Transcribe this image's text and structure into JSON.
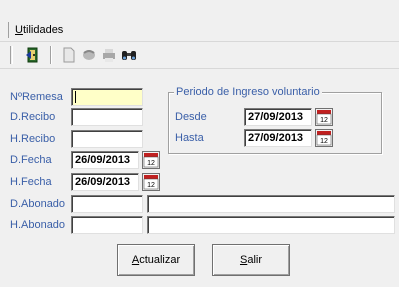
{
  "menu": {
    "utilidades": "Utilidades"
  },
  "toolbar": {
    "icons": [
      "exit-door-icon",
      "new-document-icon",
      "refresh-icon",
      "print-icon",
      "binoculars-search-icon"
    ]
  },
  "form": {
    "nremesa": {
      "label": "NºRemesa",
      "value": ""
    },
    "drecibo": {
      "label": "D.Recibo",
      "value": ""
    },
    "hrecibo": {
      "label": "H.Recibo",
      "value": ""
    },
    "dfecha": {
      "label": "D.Fecha",
      "value": "26/09/2013"
    },
    "hfecha": {
      "label": "H.Fecha",
      "value": "26/09/2013"
    },
    "dabonado": {
      "label": "D.Abonado",
      "code": "",
      "name": ""
    },
    "habonado": {
      "label": "H.Abonado",
      "code": "",
      "name": ""
    }
  },
  "periodo": {
    "title": "Periodo de Ingreso voluntario",
    "desde": {
      "label": "Desde",
      "value": "27/09/2013"
    },
    "hasta": {
      "label": "Hasta",
      "value": "27/09/2013"
    }
  },
  "buttons": {
    "actualizar": "Actualizar",
    "salir": "Salir"
  },
  "colors": {
    "label": "#3a5fa8",
    "active_field": "#ffffc8",
    "background": "#f0f0f0"
  }
}
